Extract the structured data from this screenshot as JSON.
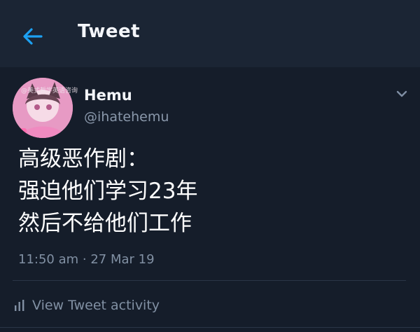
{
  "header": {
    "title": "Tweet",
    "back_icon": "arrow-left-icon",
    "accent_color": "#1da1f2"
  },
  "tweet": {
    "author": {
      "name": "Hemu",
      "handle": "@ihatehemu"
    },
    "avatar_watermark": "@美式哲学英语咨询",
    "text_lines": [
      "高级恶作剧：",
      "强迫他们学习23年",
      "然后不给他们工作"
    ],
    "timestamp": "11:50 am · 27 Mar 19",
    "activity_label": "View Tweet activity",
    "menu_icon": "chevron-down-icon",
    "activity_icon": "bar-chart-icon"
  }
}
